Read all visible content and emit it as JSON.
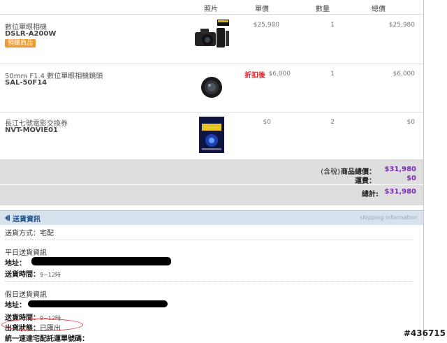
{
  "header": {
    "photo": "照片",
    "unit_price": "單價",
    "quantity": "數量",
    "total": "總價"
  },
  "items": [
    {
      "name": "數位單眼相機",
      "code": "DSLR-A200W",
      "badge": "預購商品",
      "discount_label": "",
      "unit_price": "$25,980",
      "quantity": "1",
      "total": "$25,980",
      "thumb_icon": "camera-with-lenses-icon"
    },
    {
      "name": "50mm F1.4 數位單眼相機鏡頭",
      "code": "SAL-50F14",
      "badge": "",
      "discount_label": "折扣後",
      "unit_price": "$6,000",
      "quantity": "1",
      "total": "$6,000",
      "thumb_icon": "camera-lens-icon"
    },
    {
      "name": "長江七號電影交換券",
      "code": "NVT-MOVIE01",
      "badge": "",
      "discount_label": "",
      "unit_price": "$0",
      "quantity": "2",
      "total": "$0",
      "thumb_icon": "movie-poster-icon"
    }
  ],
  "summary": {
    "tax_note": "(含稅)",
    "subtotal_label": "商品總價：",
    "subtotal": "$31,980",
    "shipping_label": "運費：",
    "shipping": "$0",
    "total_label": "總計:",
    "total": "$31,980"
  },
  "shipping_section": {
    "title": "送貨資訊",
    "title_en": "shipping information",
    "method_label": "送貨方式：",
    "method": "宅配",
    "weekday_title": "平日送貨資訊",
    "address_label": "地址：",
    "time_label": "送貨時間：",
    "weekday_time": "9~12時",
    "holiday_title": "假日送貨資訊",
    "holiday_time": "9~12時",
    "status_label": "出貨狀態：",
    "status": "已匯出",
    "invoice_label": "統一速達宅配託運單號碼："
  },
  "watermark": "#436715",
  "colors": {
    "accent_purple": "#7a2db5",
    "discount_red": "#d8232a",
    "badge_orange": "#f29a2e",
    "section_blue": "#d6e3ef"
  }
}
